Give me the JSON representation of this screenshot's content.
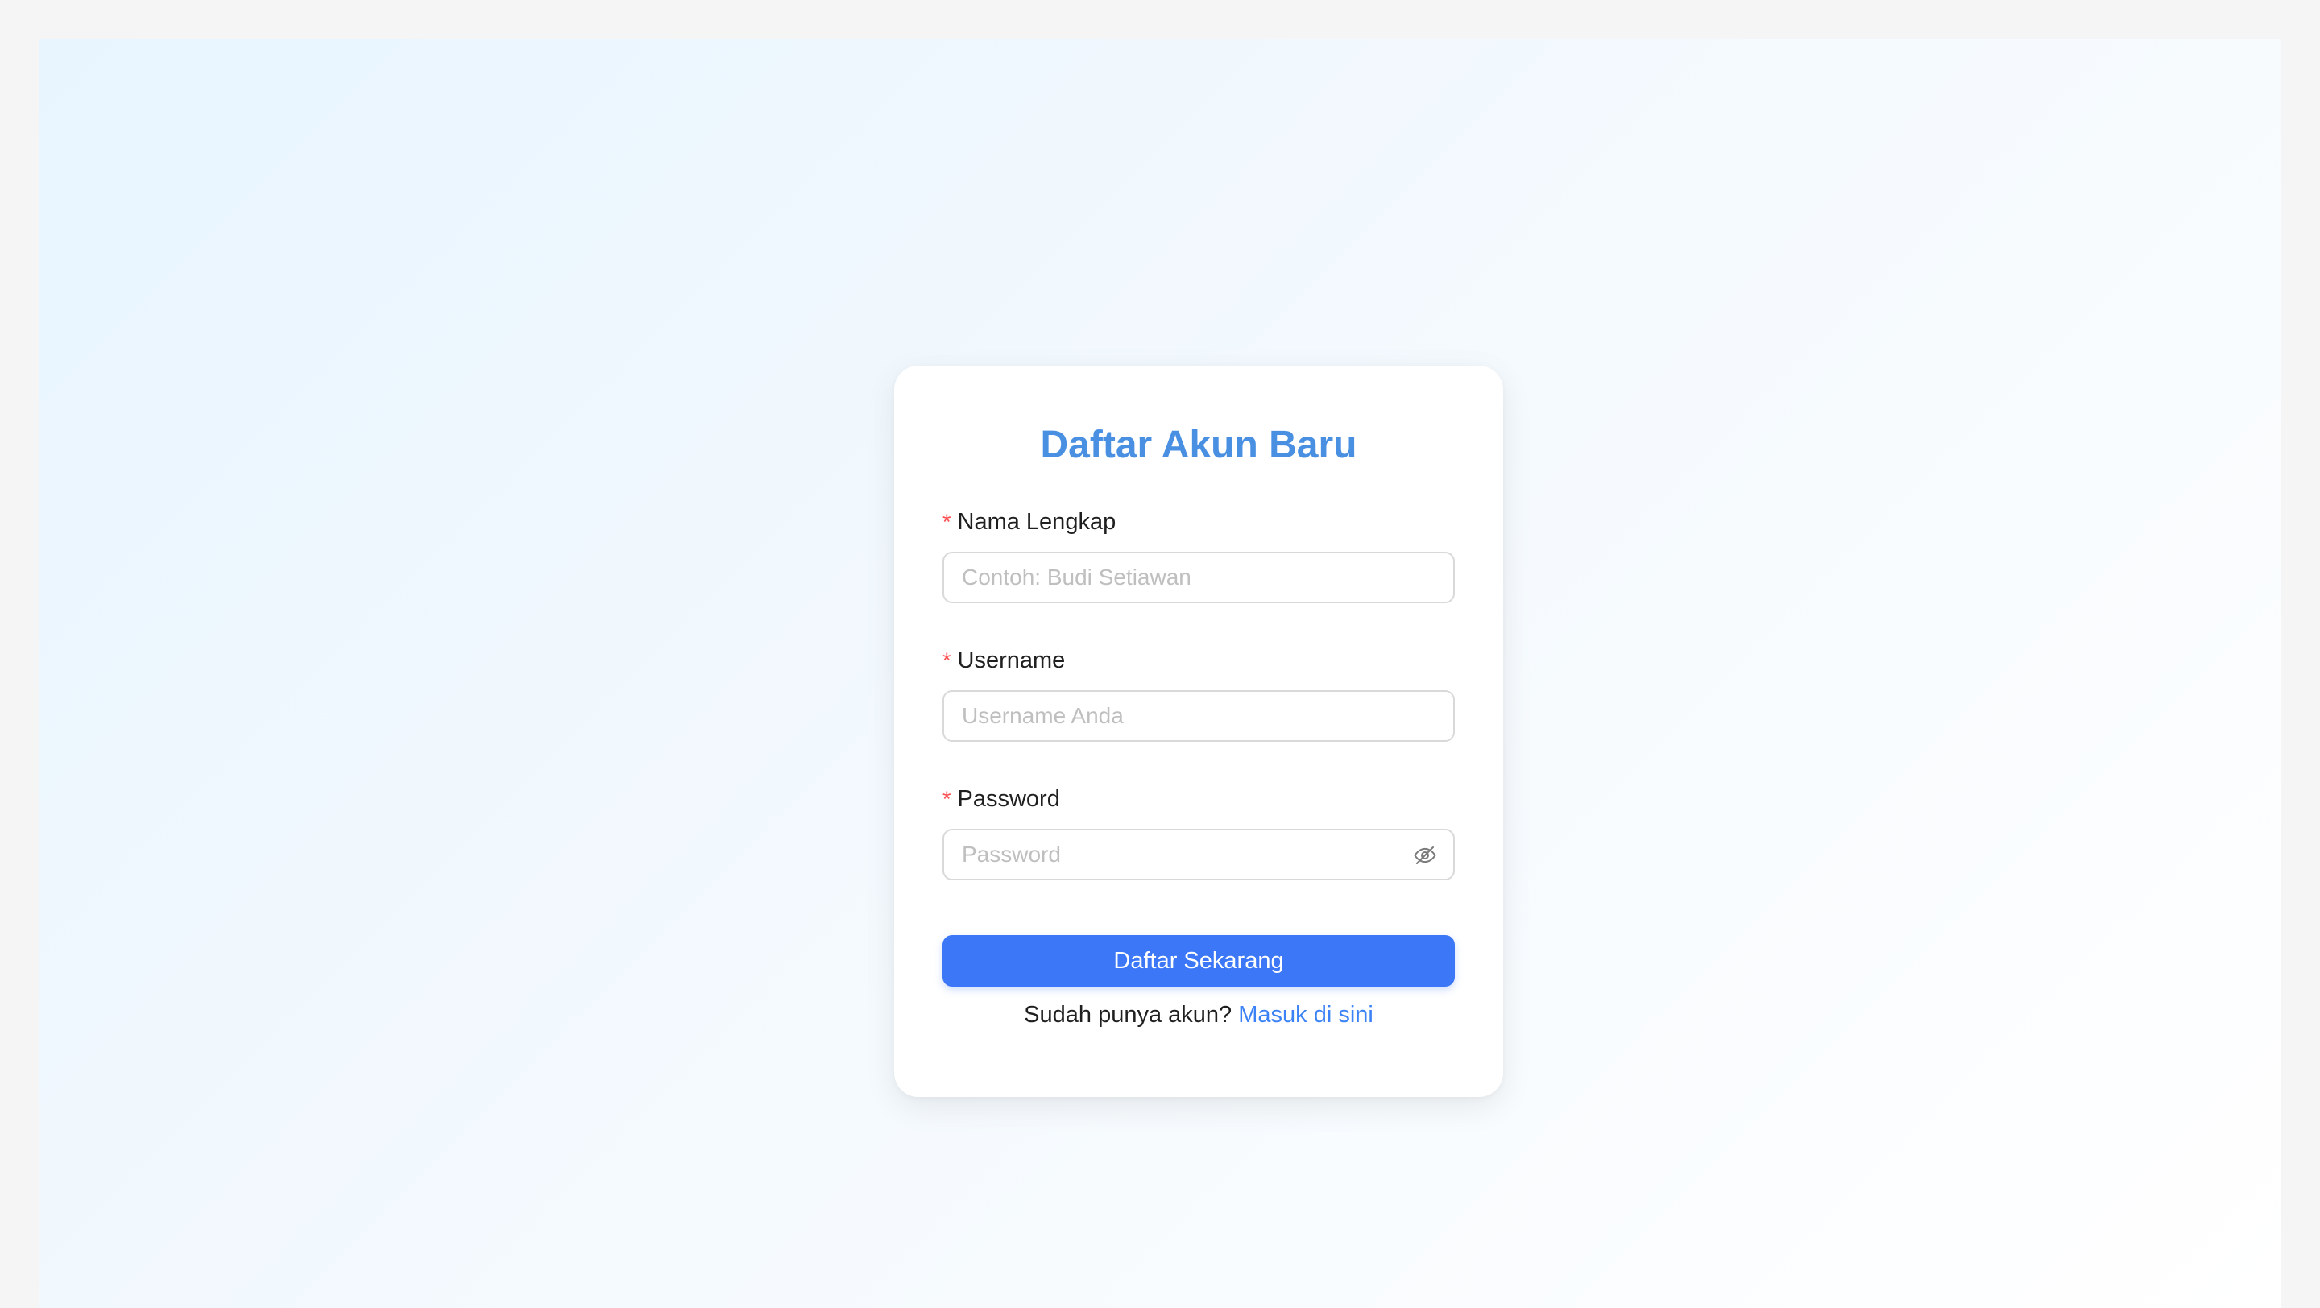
{
  "form": {
    "title": "Daftar Akun Baru",
    "required_mark": "*",
    "fields": [
      {
        "label": "Nama Lengkap",
        "placeholder": "Contoh: Budi Setiawan",
        "value": ""
      },
      {
        "label": "Username",
        "placeholder": "Username Anda",
        "value": ""
      },
      {
        "label": "Password",
        "placeholder": "Password",
        "value": "",
        "toggle_icon": "eye-slash-icon"
      }
    ],
    "submit_label": "Daftar Sekarang",
    "footer": {
      "prompt": "Sudah punya akun?",
      "link_label": "Masuk di sini"
    }
  },
  "colors": {
    "title": "#4a90e2",
    "primary_button": "#3b77f6",
    "link": "#3b82f6",
    "required": "#ff4d4f",
    "input_border": "#d9d9d9",
    "placeholder": "#bfbfbf"
  }
}
